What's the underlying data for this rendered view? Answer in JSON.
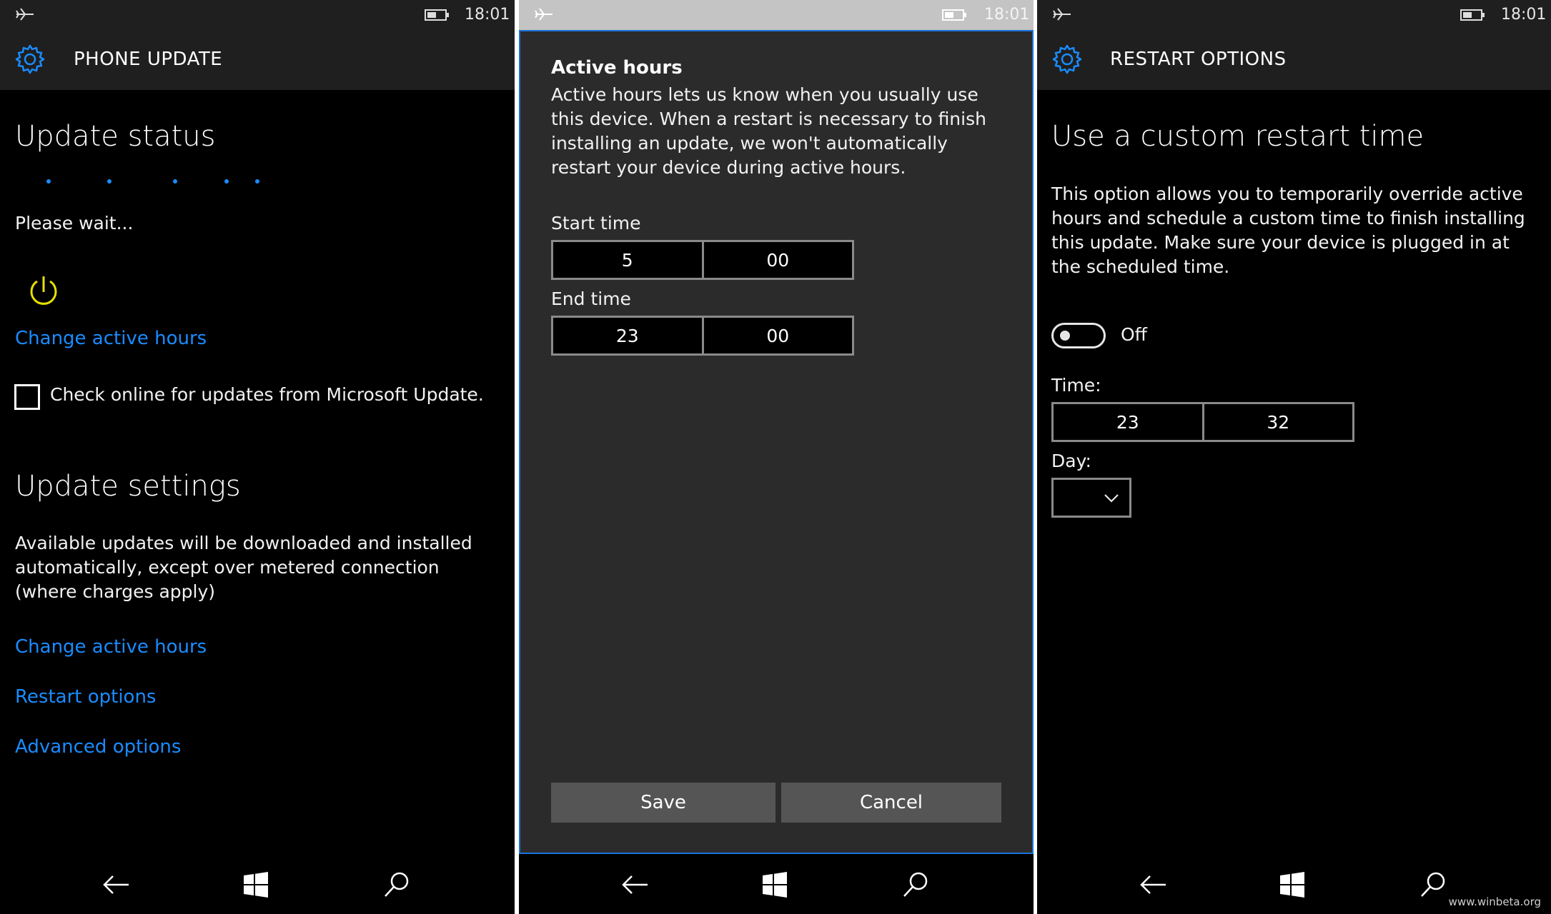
{
  "status": {
    "time": "18:01"
  },
  "panel1": {
    "header_title": "PHONE UPDATE",
    "update_status_heading": "Update status",
    "please_wait": "Please wait...",
    "change_active_hours_1": "Change active hours",
    "check_online_label": "Check online for updates from Microsoft Update.",
    "update_settings_heading": "Update settings",
    "settings_description": "Available updates will be downloaded and installed automatically, except over metered connection (where charges apply)",
    "change_active_hours_2": "Change active hours",
    "restart_options": "Restart options",
    "advanced_options": "Advanced options"
  },
  "panel2": {
    "dialog_title": "Active hours",
    "dialog_text": "Active hours lets us know when you usually use this device. When a restart is necessary to finish installing an update, we won't automatically restart your device during active hours.",
    "start_time_label": "Start time",
    "start_hour": "5",
    "start_minute": "00",
    "end_time_label": "End time",
    "end_hour": "23",
    "end_minute": "00",
    "save_label": "Save",
    "cancel_label": "Cancel"
  },
  "panel3": {
    "header_title": "RESTART OPTIONS",
    "heading": "Use a custom restart time",
    "description": "This option allows you to temporarily override active hours and schedule a custom time to finish installing this update. Make sure your device is plugged in at the scheduled time.",
    "toggle_state": "Off",
    "time_label": "Time:",
    "time_hour": "23",
    "time_minute": "32",
    "day_label": "Day:",
    "day_value": ""
  },
  "watermark": "www.winbeta.org",
  "colors": {
    "accent": "#1a8cff",
    "power_icon": "#e6e000",
    "header_bg": "#1f1f1f",
    "dialog_bg": "#2b2b2b"
  }
}
